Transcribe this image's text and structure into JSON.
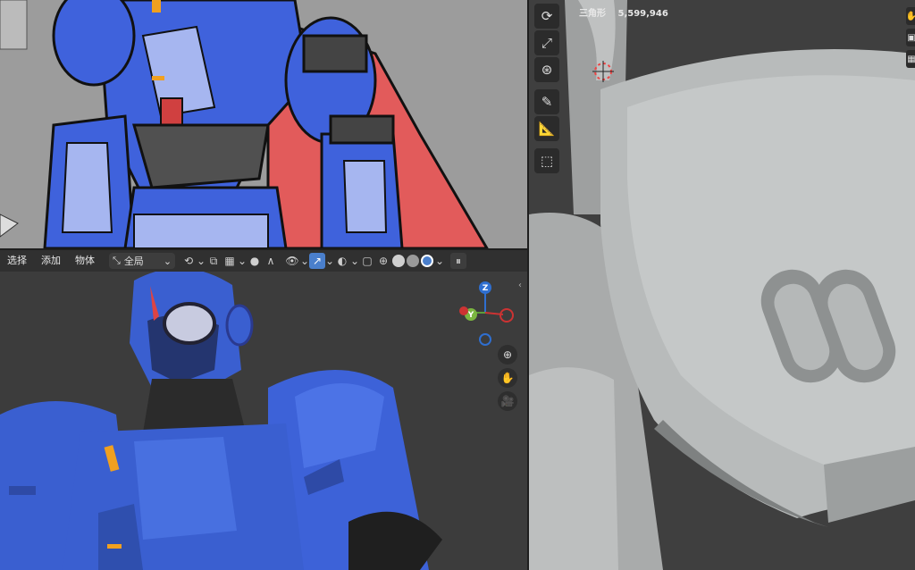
{
  "header": {
    "menu": [
      "选择",
      "添加",
      "物体"
    ],
    "orientation_label": "全局"
  },
  "stats": {
    "triangles_label": "三角形",
    "triangles_value": "5,599,946"
  },
  "gizmo": {
    "z": "Z",
    "y": "Y",
    "x": "X"
  },
  "icons": {
    "toolbar": [
      "rotate-icon",
      "scale-icon",
      "transform-icon",
      "annotate-icon",
      "measure-icon",
      "add-cube-icon"
    ],
    "nav": [
      "zoom-icon",
      "pan-hand-icon",
      "camera-icon"
    ]
  },
  "colors": {
    "armor_blue": "#3a5fd0",
    "cape_red": "#e05a5a",
    "active_blue": "#4a7fcc",
    "clay_gray": "#b9bbbb"
  }
}
